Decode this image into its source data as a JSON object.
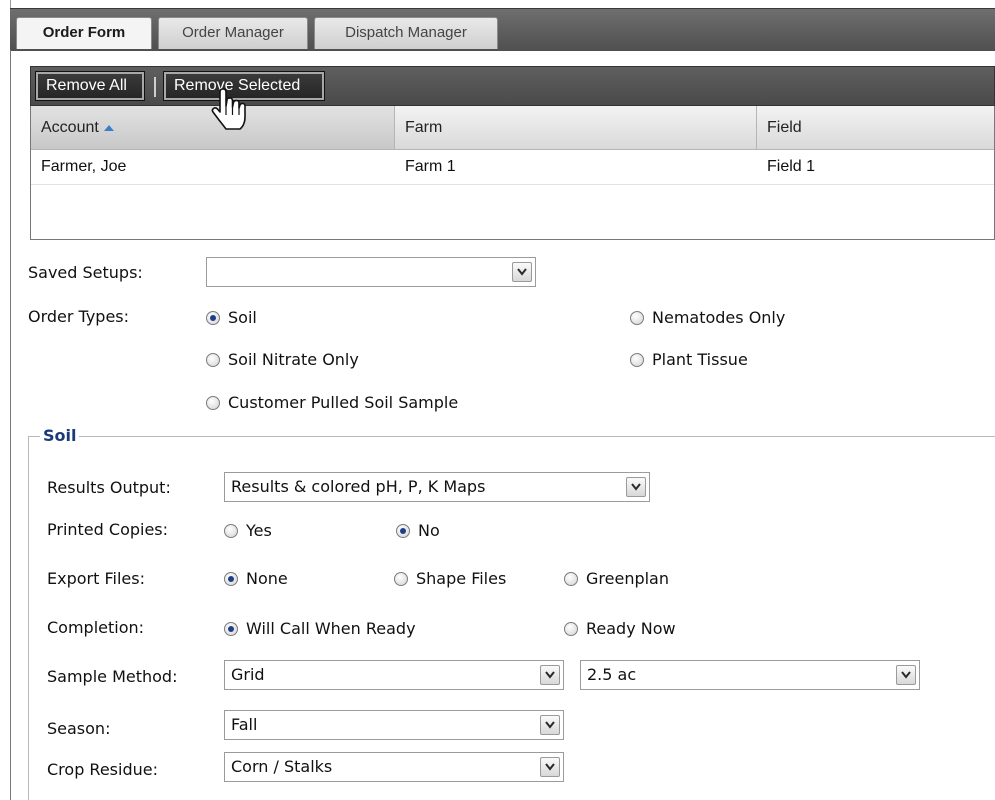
{
  "tabs": [
    {
      "label": "Order Form",
      "active": true
    },
    {
      "label": "Order Manager",
      "active": false
    },
    {
      "label": "Dispatch Manager",
      "active": false
    }
  ],
  "toolbar": {
    "remove_all": "Remove All",
    "remove_selected": "Remove Selected"
  },
  "grid": {
    "columns": [
      "Account",
      "Farm",
      "Field"
    ],
    "sorted_column": "Account",
    "rows": [
      {
        "account": "Farmer, Joe",
        "farm": "Farm 1",
        "field": "Field 1"
      }
    ]
  },
  "form": {
    "saved_setups_label": "Saved Setups:",
    "saved_setups_value": "",
    "order_types_label": "Order Types:",
    "order_types": [
      {
        "label": "Soil",
        "checked": true
      },
      {
        "label": "Nematodes Only",
        "checked": false
      },
      {
        "label": "Soil Nitrate Only",
        "checked": false
      },
      {
        "label": "Plant Tissue",
        "checked": false
      },
      {
        "label": "Customer Pulled Soil Sample",
        "checked": false
      }
    ]
  },
  "soil": {
    "legend": "Soil",
    "results_output_label": "Results Output:",
    "results_output_value": "Results & colored pH, P, K Maps",
    "printed_copies_label": "Printed Copies:",
    "printed_copies": [
      {
        "label": "Yes",
        "checked": false
      },
      {
        "label": "No",
        "checked": true
      }
    ],
    "export_files_label": "Export Files:",
    "export_files": [
      {
        "label": "None",
        "checked": true
      },
      {
        "label": "Shape Files",
        "checked": false
      },
      {
        "label": "Greenplan",
        "checked": false
      }
    ],
    "completion_label": "Completion:",
    "completion": [
      {
        "label": "Will Call When Ready",
        "checked": true
      },
      {
        "label": "Ready Now",
        "checked": false
      }
    ],
    "sample_method_label": "Sample Method:",
    "sample_method_value": "Grid",
    "grid_size_value": "2.5 ac",
    "season_label": "Season:",
    "season_value": "Fall",
    "crop_residue_label": "Crop Residue:",
    "crop_residue_value": "Corn / Stalks"
  },
  "colors": {
    "radio_dot": "#1d3f88",
    "legend_text": "#1a3a7a",
    "sort_arrow": "#3b7fc7",
    "toolbar_bg": "#4a4a4a"
  }
}
